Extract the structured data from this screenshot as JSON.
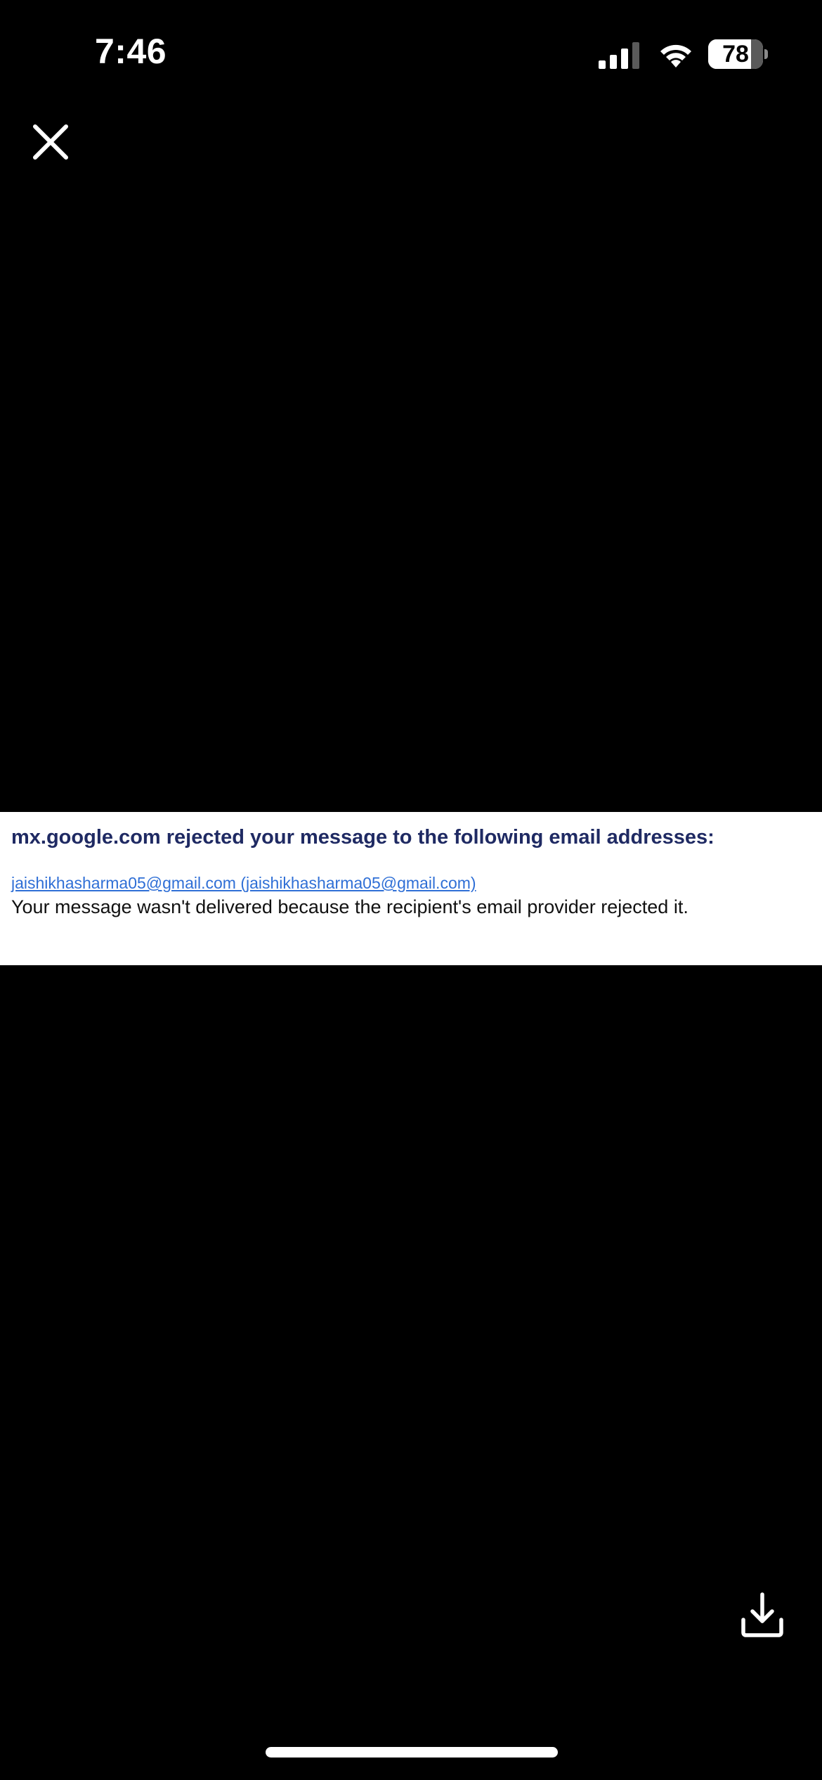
{
  "status_bar": {
    "time": "7:46",
    "battery_level": "78",
    "battery_fraction": 0.78,
    "icons": [
      "signal-icon",
      "wifi-icon",
      "battery-icon"
    ]
  },
  "toolbar": {
    "close_icon": "close-icon",
    "download_icon": "download-icon"
  },
  "image_content": {
    "heading": "mx.google.com rejected your message to the following email addresses:",
    "recipient": "jaishikhasharma05@gmail.com (jaishikhasharma05@gmail.com)",
    "message": "Your message wasn't delivered because the recipient's email provider rejected it."
  },
  "colors": {
    "background": "#000000",
    "heading": "#1f2a63",
    "link": "#2f6fd6",
    "body_text": "#111111",
    "image_background": "#ffffff"
  }
}
